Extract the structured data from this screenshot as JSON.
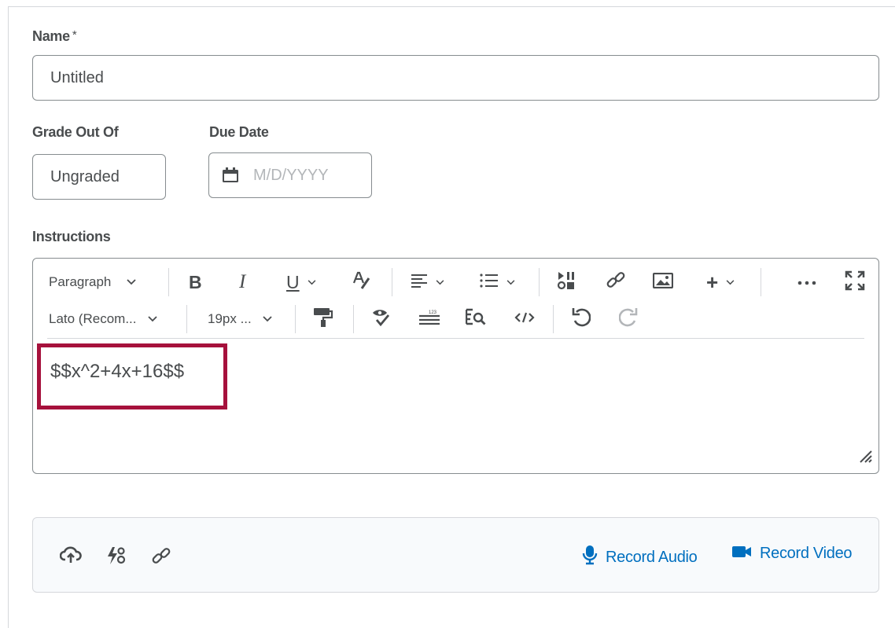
{
  "name_field": {
    "label": "Name",
    "required_marker": "*",
    "value": "Untitled"
  },
  "grade_field": {
    "label": "Grade Out Of",
    "value": "Ungraded"
  },
  "due_date_field": {
    "label": "Due Date",
    "placeholder": "M/D/YYYY"
  },
  "instructions": {
    "label": "Instructions",
    "toolbar": {
      "block_format": "Paragraph",
      "font_family": "Lato (Recom...",
      "font_size": "19px ..."
    },
    "content": "$$x^2+4x+16$$"
  },
  "attachments": {
    "record_audio": "Record Audio",
    "record_video": "Record Video"
  },
  "colors": {
    "accent": "#006fbf",
    "highlight": "#a6113c",
    "border": "#868c8f"
  },
  "icons": [
    "calendar-icon",
    "bold-icon",
    "italic-icon",
    "underline-icon",
    "text-color-icon",
    "align-icon",
    "list-icon",
    "insert-stuff-icon",
    "link-icon",
    "image-icon",
    "plus-icon",
    "more-icon",
    "fullscreen-icon",
    "format-painter-icon",
    "spellcheck-icon",
    "word-count-icon",
    "find-replace-icon",
    "source-code-icon",
    "undo-icon",
    "redo-icon",
    "upload-icon",
    "quicklink-icon",
    "attach-link-icon",
    "microphone-icon",
    "video-camera-icon"
  ]
}
